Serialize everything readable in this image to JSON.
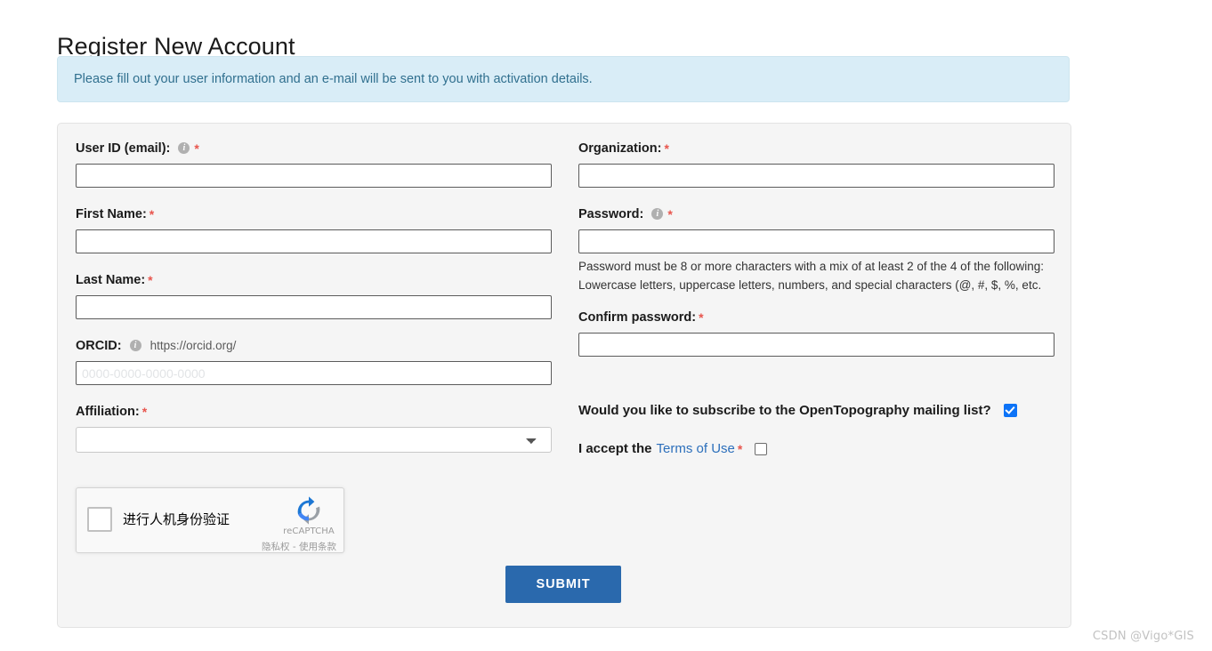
{
  "page": {
    "title": "Register New Account",
    "alert_message": "Please fill out your user information and an e-mail will be sent to you with activation details.",
    "watermark": "CSDN @Vigo*GIS"
  },
  "colors": {
    "alert_bg": "#d9edf7",
    "alert_text": "#31708f",
    "panel_bg": "#f5f5f5",
    "required_star": "#e8554d",
    "link": "#2c6fbb",
    "submit_bg": "#2a69ad",
    "checkbox_checked": "#0d73f7"
  },
  "form": {
    "required_marker": "*",
    "left_column": {
      "user_id": {
        "label": "User ID (email):",
        "info_icon": "info-icon",
        "required": true,
        "value": "",
        "placeholder": ""
      },
      "first_name": {
        "label": "First Name:",
        "required": true,
        "value": "",
        "placeholder": ""
      },
      "last_name": {
        "label": "Last Name:",
        "required": true,
        "value": "",
        "placeholder": ""
      },
      "orcid": {
        "label": "ORCID:",
        "info_icon": "info-icon",
        "url_prefix": "https://orcid.org/",
        "required": false,
        "value": "",
        "placeholder": "0000-0000-0000-0000"
      },
      "affiliation": {
        "label": "Affiliation:",
        "required": true,
        "selected": "",
        "options": [
          ""
        ]
      }
    },
    "right_column": {
      "organization": {
        "label": "Organization:",
        "required": true,
        "value": "",
        "placeholder": ""
      },
      "password": {
        "label": "Password:",
        "info_icon": "info-icon",
        "required": true,
        "value": "",
        "placeholder": "",
        "help_text": "Password must be 8 or more characters with a mix of at least 2 of the 4 of the following: Lowercase letters, uppercase letters, numbers, and special characters (@, #, $, %, etc."
      },
      "confirm_password": {
        "label": "Confirm password:",
        "required": true,
        "value": "",
        "placeholder": ""
      },
      "subscribe": {
        "label": "Would you like to subscribe to the OpenTopography mailing list?",
        "checked": true
      },
      "accept_terms": {
        "lead_text": "I accept the",
        "link_text": "Terms of Use",
        "required": true,
        "checked": false
      }
    },
    "recaptcha": {
      "checkbox_label": "进行人机身份验证",
      "brand": "reCAPTCHA",
      "terms": "隐私权 - 使用条款",
      "checked": false
    },
    "submit_label": "SUBMIT"
  }
}
